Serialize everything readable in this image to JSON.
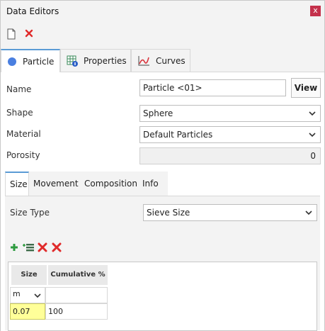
{
  "window": {
    "title": "Data Editors",
    "close_label": "x"
  },
  "toolbar": {
    "new_icon": "new-document-icon",
    "delete_icon": "delete-icon"
  },
  "tabs": [
    {
      "label": "Particle",
      "icon": "particle-circle-icon",
      "active": true
    },
    {
      "label": "Properties",
      "icon": "properties-grid-icon",
      "active": false
    },
    {
      "label": "Curves",
      "icon": "curves-chart-icon",
      "active": false
    }
  ],
  "form": {
    "name_label": "Name",
    "name_value": "Particle <01>",
    "view_label": "View",
    "shape_label": "Shape",
    "shape_value": "Sphere",
    "material_label": "Material",
    "material_value": "Default Particles",
    "porosity_label": "Porosity",
    "porosity_value": "0"
  },
  "subtabs": [
    {
      "label": "Size",
      "active": true
    },
    {
      "label": "Movement",
      "active": false
    },
    {
      "label": "Composition",
      "active": false
    },
    {
      "label": "Info",
      "active": false
    }
  ],
  "size": {
    "type_label": "Size Type",
    "type_value": "Sieve Size",
    "table": {
      "columns": [
        "Size",
        "Cumulative %"
      ],
      "unit": "m",
      "rows": [
        {
          "size": "0.07",
          "cumulative": "100"
        }
      ]
    }
  },
  "colors": {
    "accent": "#5b9bd5",
    "close": "#c4314b",
    "highlight": "#ffff99",
    "add": "#2e9b3f",
    "remove": "#e02a2a"
  }
}
